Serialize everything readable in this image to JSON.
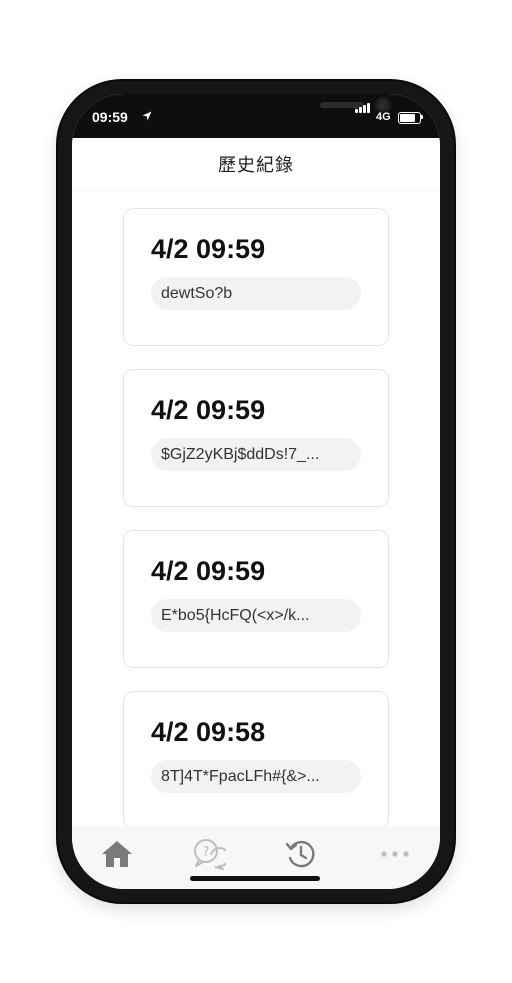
{
  "status_bar": {
    "time": "09:59",
    "network": "4G"
  },
  "header": {
    "title": "歷史紀錄"
  },
  "history": [
    {
      "datetime": "4/2 09:59",
      "text": "dewtSo?b"
    },
    {
      "datetime": "4/2 09:59",
      "text": "$GjZ2yKBj$ddDs!7_..."
    },
    {
      "datetime": "4/2 09:59",
      "text": "E*bo5{HcFQ(<x>/k..."
    },
    {
      "datetime": "4/2 09:58",
      "text": "8T]4T*FpacLFh#{&>..."
    }
  ],
  "tab_bar": {
    "items": [
      {
        "icon": "home-icon"
      },
      {
        "icon": "help-chat-icon"
      },
      {
        "icon": "history-icon"
      },
      {
        "icon": "more-icon"
      }
    ]
  },
  "colors": {
    "phone_frame": "#161616",
    "card_border": "#e5e5e5",
    "pill_bg": "#f2f2f2",
    "tab_icon": "#bdbdbd",
    "tab_icon_active": "#7a7a7a"
  }
}
